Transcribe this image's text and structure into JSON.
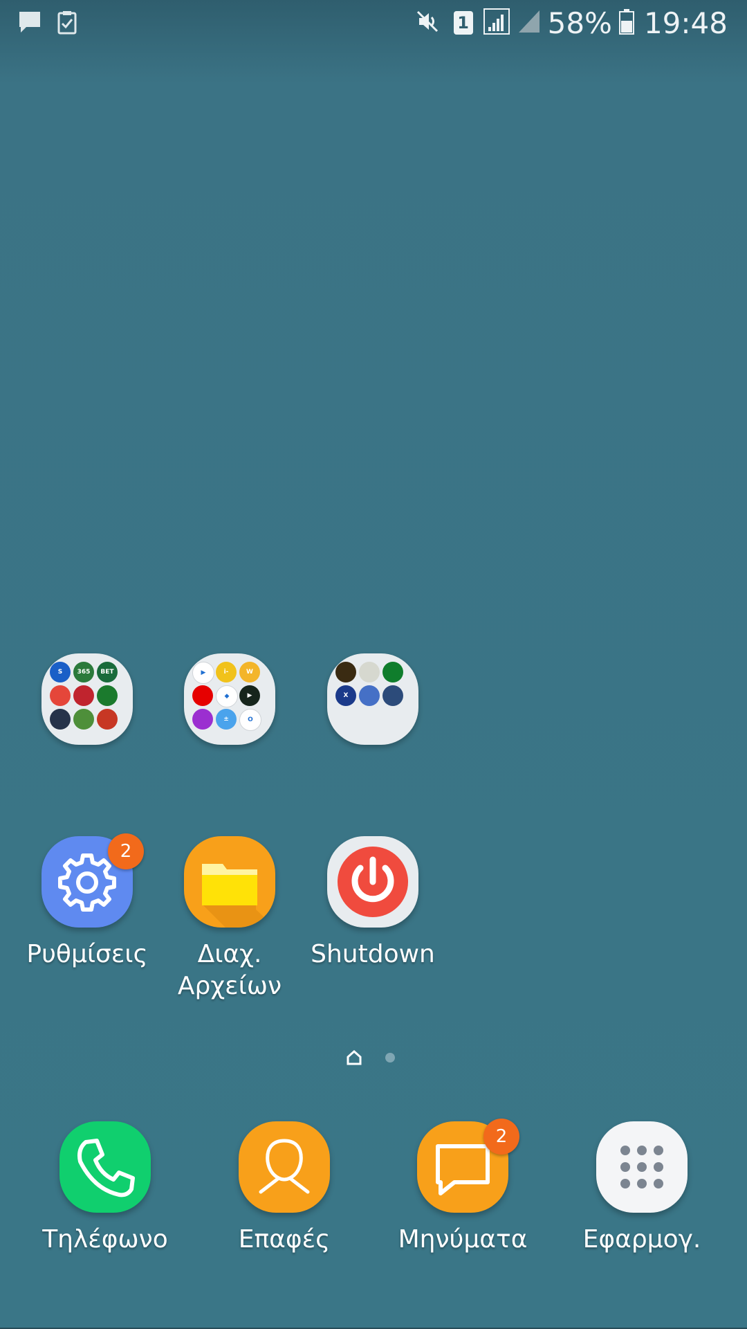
{
  "status_bar": {
    "left_icons": [
      "message-notification-icon",
      "task-checklist-icon"
    ],
    "right_icons": [
      "mute-icon",
      "sim-1-icon",
      "signal-icon",
      "signal-empty-icon",
      "battery-icon"
    ],
    "sim_label": "1",
    "battery": "58%",
    "time": "19:48"
  },
  "folders": [
    {
      "icons": [
        {
          "name": "s-app-icon",
          "color": "#1a5fc7",
          "text": "S"
        },
        {
          "name": "bet365-icon",
          "color": "#2b7a3b",
          "text": "365"
        },
        {
          "name": "bet-app-icon",
          "color": "#196b3b",
          "text": "BET"
        },
        {
          "name": "ball-app-icon",
          "color": "#e5463a",
          "text": ""
        },
        {
          "name": "red-octopus-icon",
          "color": "#c0242e",
          "text": ""
        },
        {
          "name": "green-ring-icon",
          "color": "#1b7a2d",
          "text": ""
        },
        {
          "name": "news-app-icon",
          "color": "#26334a",
          "text": ""
        },
        {
          "name": "football-app-icon",
          "color": "#4e8f3a",
          "text": ""
        },
        {
          "name": "red-sport-icon",
          "color": "#c73724",
          "text": ""
        }
      ]
    },
    {
      "icons": [
        {
          "name": "play-store-icon",
          "color": "#ffffff",
          "text": "▶"
        },
        {
          "name": "ibank-icon",
          "color": "#f1c21b",
          "text": "i-bank"
        },
        {
          "name": "winbank-icon",
          "color": "#f3b52a",
          "text": "W"
        },
        {
          "name": "vodafone-icon",
          "color": "#e60000",
          "text": ""
        },
        {
          "name": "blue-diamond-icon",
          "color": "#ffffff",
          "text": "◆"
        },
        {
          "name": "video-play-icon",
          "color": "#16251c",
          "text": "▶"
        },
        {
          "name": "uc-browser-icon",
          "color": "#9b2fd0",
          "text": ""
        },
        {
          "name": "calculator-icon",
          "color": "#4aa3ec",
          "text": "±"
        },
        {
          "name": "opera-icon",
          "color": "#ffffff",
          "text": "O"
        }
      ]
    },
    {
      "icons": [
        {
          "name": "game-app-icon",
          "color": "#3a2b12",
          "text": ""
        },
        {
          "name": "soccer-app-icon",
          "color": "#d6d8cf",
          "text": ""
        },
        {
          "name": "green-target-icon",
          "color": "#0f7d2c",
          "text": ""
        },
        {
          "name": "xbox-app-icon",
          "color": "#1b3a8a",
          "text": "X"
        },
        {
          "name": "trash-app-icon",
          "color": "#4570c6",
          "text": ""
        },
        {
          "name": "android-app-icon",
          "color": "#2c4b7a",
          "text": ""
        }
      ]
    }
  ],
  "apps": [
    {
      "label": "Ρυθμίσεις",
      "badge": "2"
    },
    {
      "label": "Διαχ.\nΑρχείων",
      "badge": ""
    },
    {
      "label": "Shutdown",
      "badge": ""
    }
  ],
  "dock": [
    {
      "label": "Τηλέφωνο",
      "badge": ""
    },
    {
      "label": "Επαφές",
      "badge": ""
    },
    {
      "label": "Μηνύματα",
      "badge": "2"
    },
    {
      "label": "Εφαρμογ.",
      "badge": ""
    }
  ],
  "page_indicator": {
    "pages": 2,
    "current": 1
  },
  "colors": {
    "wallpaper": "#3a7687",
    "badge": "#f26a1b",
    "settings": "#5f8af0",
    "files": "#f8a01a",
    "shutdown_red": "#f04b3e",
    "phone": "#10cf6e",
    "contacts": "#f8a01a",
    "messages": "#f8a01a"
  }
}
